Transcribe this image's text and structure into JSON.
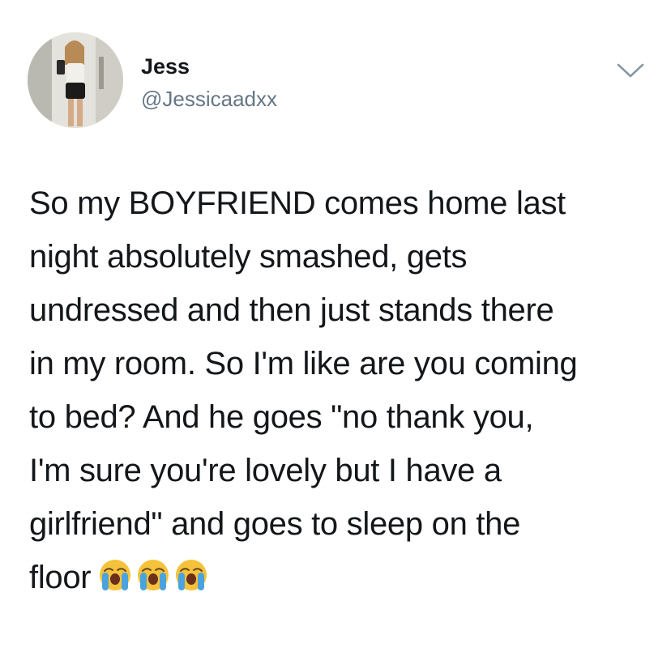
{
  "user": {
    "display_name": "Jess",
    "handle": "@Jessicaadxx"
  },
  "tweet": {
    "lines": [
      "So my BOYFRIEND comes home last",
      "night absolutely smashed, gets",
      "undressed and then just stands there",
      "in my room. So I'm like are you coming",
      "to bed? And he goes \"no thank you,",
      "I'm sure you're lovely but I have a",
      "girlfriend\" and goes to sleep on the",
      "floor"
    ],
    "emojis": [
      "loudly-crying-face-icon",
      "loudly-crying-face-icon",
      "loudly-crying-face-icon"
    ]
  },
  "icons": {
    "caret": "chevron-down-icon"
  },
  "colors": {
    "text": "#14171a",
    "secondary": "#657786",
    "caret": "#8899a6",
    "emoji_face": "#f5c33b",
    "emoji_tears": "#4aa3df"
  }
}
